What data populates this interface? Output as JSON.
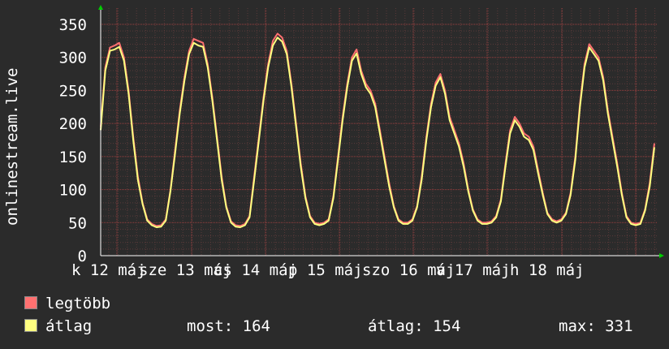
{
  "chart_data": {
    "type": "line",
    "ylabel": "onlinestream.live",
    "ylim": [
      0,
      350
    ],
    "yticks": [
      "0",
      "50",
      "100",
      "150",
      "200",
      "250",
      "300",
      "350"
    ],
    "xtick_labels": [
      "k 12 máj",
      "sze 13 máj",
      "cs 14 máj",
      "p 15 máj",
      "szo 16 máj",
      "v 17 máj",
      "h 18 máj"
    ],
    "grid": true,
    "series": [
      {
        "name": "legtöbb",
        "color": "#ff7070",
        "values": [
          195,
          285,
          315,
          318,
          322,
          300,
          250,
          180,
          120,
          80,
          55,
          48,
          45,
          46,
          55,
          100,
          160,
          220,
          270,
          310,
          328,
          325,
          322,
          290,
          240,
          180,
          120,
          75,
          52,
          46,
          45,
          48,
          60,
          120,
          180,
          240,
          290,
          325,
          336,
          330,
          310,
          260,
          200,
          140,
          90,
          60,
          50,
          48,
          50,
          55,
          90,
          150,
          210,
          260,
          300,
          312,
          280,
          260,
          250,
          230,
          190,
          150,
          110,
          75,
          55,
          50,
          50,
          55,
          75,
          120,
          180,
          230,
          262,
          275,
          250,
          210,
          190,
          170,
          140,
          100,
          70,
          55,
          50,
          50,
          52,
          60,
          85,
          140,
          190,
          210,
          200,
          185,
          180,
          165,
          130,
          95,
          65,
          55,
          52,
          55,
          65,
          95,
          150,
          230,
          290,
          320,
          310,
          300,
          270,
          220,
          180,
          140,
          95,
          60,
          50,
          48,
          50,
          70,
          110,
          170
        ]
      },
      {
        "name": "átlag",
        "color": "#ffff80",
        "values": [
          190,
          280,
          310,
          312,
          316,
          295,
          245,
          175,
          115,
          78,
          53,
          46,
          43,
          44,
          53,
          98,
          155,
          215,
          265,
          305,
          322,
          318,
          316,
          285,
          235,
          175,
          115,
          73,
          50,
          44,
          43,
          46,
          58,
          115,
          175,
          235,
          285,
          318,
          330,
          324,
          305,
          255,
          195,
          135,
          87,
          58,
          48,
          46,
          48,
          53,
          87,
          145,
          205,
          255,
          295,
          306,
          275,
          255,
          245,
          225,
          185,
          145,
          105,
          73,
          53,
          48,
          48,
          53,
          73,
          115,
          175,
          225,
          257,
          270,
          245,
          205,
          185,
          165,
          135,
          97,
          68,
          53,
          48,
          48,
          50,
          58,
          82,
          135,
          185,
          205,
          195,
          180,
          175,
          160,
          125,
          92,
          63,
          53,
          50,
          53,
          63,
          92,
          145,
          225,
          285,
          315,
          305,
          295,
          265,
          215,
          175,
          135,
          92,
          58,
          48,
          46,
          48,
          68,
          105,
          164
        ]
      }
    ],
    "legend": {
      "placement": "bottom-left"
    }
  },
  "legend": {
    "items": [
      {
        "label": "legtöbb",
        "color": "#ff7070"
      },
      {
        "label": "átlag",
        "color": "#ffff80"
      }
    ]
  },
  "stats": {
    "most": "most: 164",
    "atlag": "átlag: 154",
    "max": "max: 331"
  }
}
